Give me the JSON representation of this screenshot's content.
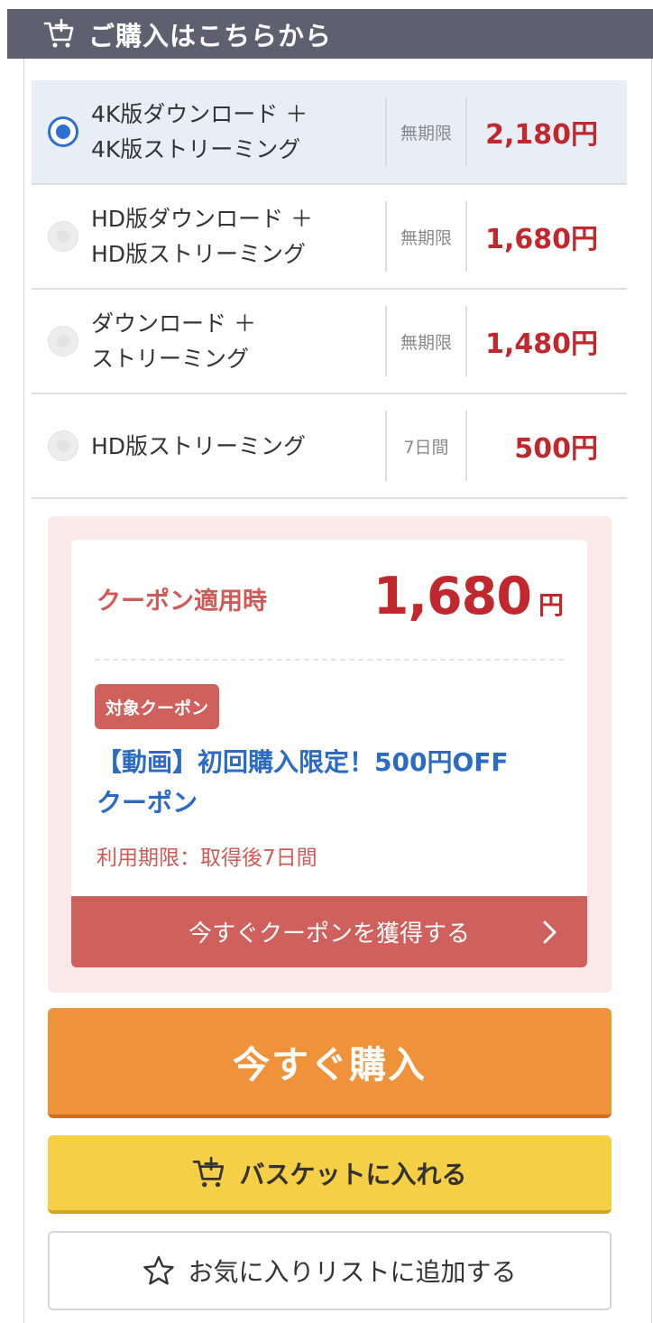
{
  "header": {
    "title": "ご購入はこちらから"
  },
  "options": [
    {
      "line1": "4K版ダウンロード ＋",
      "line2": "4K版ストリーミング",
      "period": "無期限",
      "price": "2,180円",
      "selected": true
    },
    {
      "line1": "HD版ダウンロード ＋",
      "line2": "HD版ストリーミング",
      "period": "無期限",
      "price": "1,680円",
      "selected": false
    },
    {
      "line1": "ダウンロード ＋",
      "line2": "ストリーミング",
      "period": "無期限",
      "price": "1,480円",
      "selected": false
    },
    {
      "line1": "HD版ストリーミング",
      "line2": "",
      "period": "7日間",
      "price": "500円",
      "selected": false
    }
  ],
  "coupon": {
    "applied_label": "クーポン適用時",
    "price_value": "1,680",
    "price_unit": "円",
    "badge": "対象クーポン",
    "name_line1": "【動画】初回購入限定！500円OFF",
    "name_line2": "クーポン",
    "expiry": "利用期限：取得後7日間",
    "get_button": "今すぐクーポンを獲得する"
  },
  "buttons": {
    "buy_now": "今すぐ購入",
    "add_basket": "バスケットに入れる",
    "add_favorites": "お気に入りリストに追加する"
  },
  "colors": {
    "header_bg": "#5e6070",
    "price_red": "#c0282d",
    "coupon_red": "#cf605b",
    "coupon_blue": "#2a6bc6",
    "buy_orange": "#f0923a",
    "basket_yellow": "#f5cf45",
    "selected_bg": "#e7eef7"
  },
  "icons": {
    "header": "cart-plus-icon",
    "basket": "cart-plus-icon",
    "favorites": "star-outline-icon",
    "coupon_get": "chevron-right-icon"
  }
}
